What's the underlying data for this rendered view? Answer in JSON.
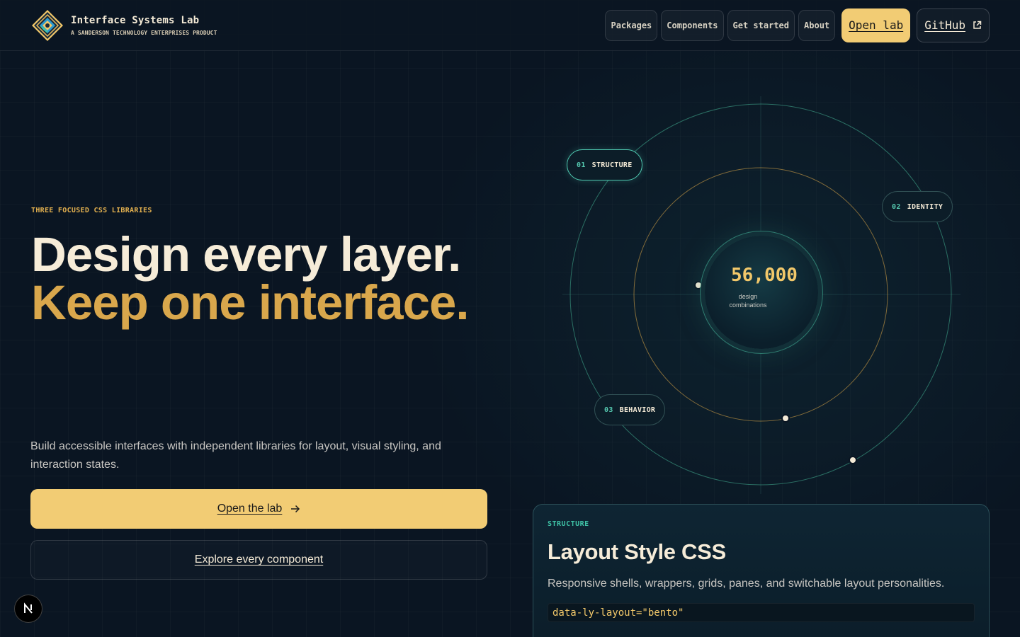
{
  "brand": {
    "title": "Interface Systems Lab",
    "subtitle": "A SANDERSON TECHNOLOGY ENTERPRISES PRODUCT"
  },
  "nav": {
    "items": [
      {
        "label": "Packages"
      },
      {
        "label": "Components"
      },
      {
        "label": "Get started"
      },
      {
        "label": "About"
      }
    ],
    "primary_label": "Open lab",
    "github_label": "GitHub"
  },
  "hero": {
    "eyebrow": "THREE FOCUSED CSS LIBRARIES",
    "headline_line1": "Design every layer.",
    "headline_line2": "Keep one interface.",
    "lede": "Build accessible interfaces with independent libraries for layout, visual styling, and interaction states.",
    "cta_primary": "Open the lab",
    "cta_secondary": "Explore every component"
  },
  "orbit": {
    "core_value": "56,000",
    "core_label_1": "design",
    "core_label_2": "combinations",
    "chips": [
      {
        "num": "01",
        "label": "STRUCTURE"
      },
      {
        "num": "02",
        "label": "IDENTITY"
      },
      {
        "num": "03",
        "label": "BEHAVIOR"
      }
    ]
  },
  "card": {
    "tag": "STRUCTURE",
    "title": "Layout Style CSS",
    "description": "Responsive shells, wrappers, grids, panes, and switchable layout personalities.",
    "code": "data-ly-layout=\"bento\""
  },
  "colors": {
    "background": "#0a1522",
    "accent_gold": "#f2cc74",
    "headline_gold": "#d9a74c",
    "teal": "#4fc8b0"
  },
  "icons": {
    "brand": "diamond-logo-icon",
    "external": "external-link-icon",
    "arrow": "arrow-right-icon",
    "next": "nextjs-icon"
  }
}
